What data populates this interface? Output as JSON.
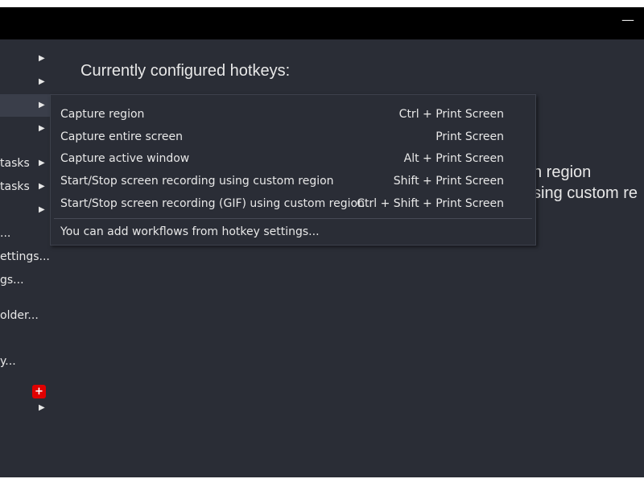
{
  "window": {
    "minimize_label": "—"
  },
  "sidebar": {
    "items": [
      {
        "label": "",
        "has_arrow": true
      },
      {
        "label": "",
        "has_arrow": true
      },
      {
        "label": "",
        "has_arrow": true
      },
      {
        "label": "",
        "has_arrow": true
      },
      {
        "label": "tasks",
        "has_arrow": true
      },
      {
        "label": "tasks",
        "has_arrow": true
      },
      {
        "label": "",
        "has_arrow": true
      },
      {
        "label": "...",
        "has_arrow": false
      },
      {
        "label": "ettings...",
        "has_arrow": false
      },
      {
        "label": "gs...",
        "has_arrow": false
      },
      {
        "label": "older...",
        "has_arrow": false
      },
      {
        "label": "y...",
        "has_arrow": false
      },
      {
        "label": "",
        "has_arrow": false
      },
      {
        "label": "",
        "has_arrow": true
      }
    ],
    "arrow_glyph": "▶",
    "plus_badge": "+"
  },
  "main": {
    "heading": "Currently configured hotkeys:",
    "bg_line1": "n region",
    "bg_line2": "sing custom re"
  },
  "submenu": {
    "items": [
      {
        "label": "Capture region",
        "shortcut": "Ctrl + Print Screen"
      },
      {
        "label": "Capture entire screen",
        "shortcut": "Print Screen"
      },
      {
        "label": "Capture active window",
        "shortcut": "Alt + Print Screen"
      },
      {
        "label": "Start/Stop screen recording using custom region",
        "shortcut": "Shift + Print Screen"
      },
      {
        "label": "Start/Stop screen recording (GIF) using custom region",
        "shortcut": "Ctrl + Shift + Print Screen"
      }
    ],
    "footer": "You can add workflows from hotkey settings..."
  },
  "colors": {
    "background": "#2a2d36",
    "titlebar": "#000000",
    "text": "#e8e8e8",
    "badge": "#e00000"
  }
}
